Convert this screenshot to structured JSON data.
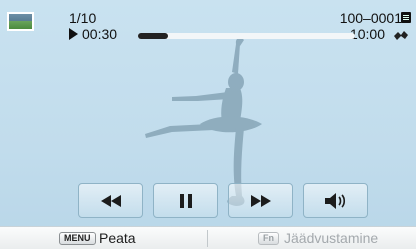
{
  "header": {
    "counter": "1/10",
    "elapsed": "00:30",
    "file_id": "100–0001",
    "duration": "10:00",
    "icons": [
      "thumbnail-icon",
      "play-icon",
      "battery-icon",
      "stabilizer-icon"
    ]
  },
  "playback": {
    "progress_fraction": 0.14
  },
  "controls": [
    {
      "name": "rewind-button",
      "icon": "rewind-icon"
    },
    {
      "name": "pause-button",
      "icon": "pause-icon"
    },
    {
      "name": "fast-forward-button",
      "icon": "fast-forward-icon"
    },
    {
      "name": "volume-button",
      "icon": "volume-icon"
    }
  ],
  "bottom_bar": {
    "menu_key": "MENU",
    "menu_label": "Peata",
    "fn_key": "Fn",
    "fn_label": "Jäädvustamine"
  },
  "colors": {
    "sky": "#c4deed",
    "silhouette": "#8aa8ba",
    "progress": "#222222",
    "disabled_text": "#a4a9ad"
  }
}
